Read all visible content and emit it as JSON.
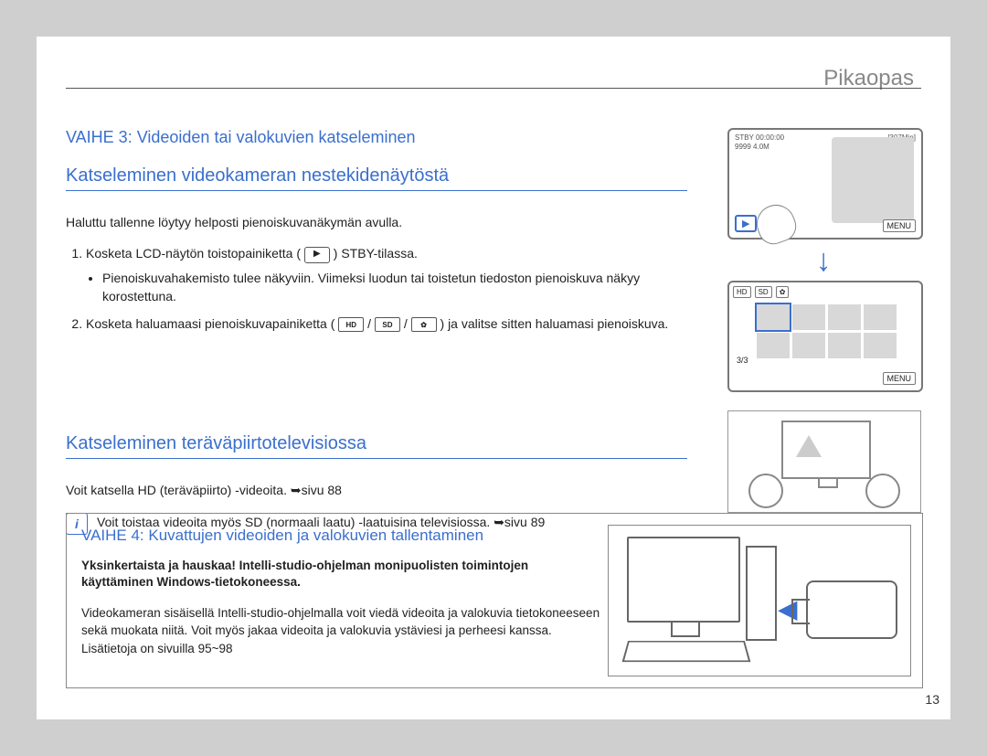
{
  "page": {
    "title": "Pikaopas",
    "number": "13"
  },
  "step3": {
    "heading": "VAIHE 3: Videoiden tai valokuvien katseleminen",
    "sub_a": "Katseleminen videokameran nestekidenäytöstä",
    "intro_a": "Haluttu tallenne löytyy helposti pienoiskuvanäkymän avulla.",
    "li1_a": "Kosketa LCD-näytön toistopainiketta (",
    "li1_b": ") STBY-tilassa.",
    "li1_bullet": "Pienoiskuvahakemisto tulee näkyviin. Viimeksi luodun tai toistetun tiedoston pienoiskuva näkyy korostettuna.",
    "li2_a": "Kosketa haluamaasi pienoiskuvapainiketta (",
    "li2_b": ") ja valitse sitten haluamasi pienoiskuva.",
    "icon_play": "▶",
    "icon_hd": "HD",
    "icon_sd": "SD",
    "icon_photo": "✿",
    "sub_b": "Katseleminen teräväpiirtotelevisiossa",
    "body_b": "Voit katsella HD (teräväpiirto) -videoita. ",
    "ref_b": "➥sivu 88",
    "info_b": "Voit toistaa videoita myös SD (normaali laatu) -laatuisina televisiossa. ",
    "info_b_ref": "➥sivu 89"
  },
  "step4": {
    "heading": "VAIHE 4: Kuvattujen videoiden ja valokuvien tallentaminen",
    "bold": "Yksinkertaista ja hauskaa! Intelli-studio-ohjelman monipuolisten toimintojen käyttäminen Windows-tietokoneessa.",
    "body": "Videokameran sisäisellä Intelli-studio-ohjelmalla voit viedä videoita ja valokuvia tietokoneeseen sekä muokata niitä. Voit myös jakaa videoita ja valokuvia ystäviesi ja perheesi kanssa. Lisätietoja on sivuilla 95~98"
  },
  "lcd": {
    "status_left": "STBY  00:00:00",
    "status_right": "[307Min]",
    "row2_left": "9999  4.0M",
    "menu": "MENU",
    "play": "▶",
    "arrow_down": "↓",
    "page_indicator": "3/3"
  }
}
